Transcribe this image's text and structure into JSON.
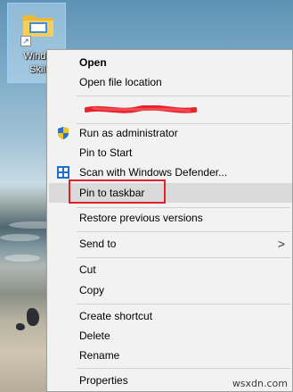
{
  "desktop": {
    "icon_label_line1": "Windo",
    "icon_label_line2": "Skil"
  },
  "menu": {
    "open": "Open",
    "open_file_location": "Open file location",
    "run_as_admin": "Run as administrator",
    "pin_to_start": "Pin to Start",
    "scan_defender": "Scan with Windows Defender...",
    "pin_to_taskbar": "Pin to taskbar",
    "restore_versions": "Restore previous versions",
    "send_to": "Send to",
    "cut": "Cut",
    "copy": "Copy",
    "create_shortcut": "Create shortcut",
    "delete": "Delete",
    "rename": "Rename",
    "properties": "Properties"
  },
  "colors": {
    "highlight_border": "#e0202a",
    "hover_bg": "#dadada",
    "menu_bg": "#f2f2f2"
  },
  "icons": {
    "run_as_admin": "uac-shield-icon",
    "scan_defender": "windows-defender-icon",
    "send_to": "chevron-right-icon"
  },
  "watermark": "wsxdn.com"
}
